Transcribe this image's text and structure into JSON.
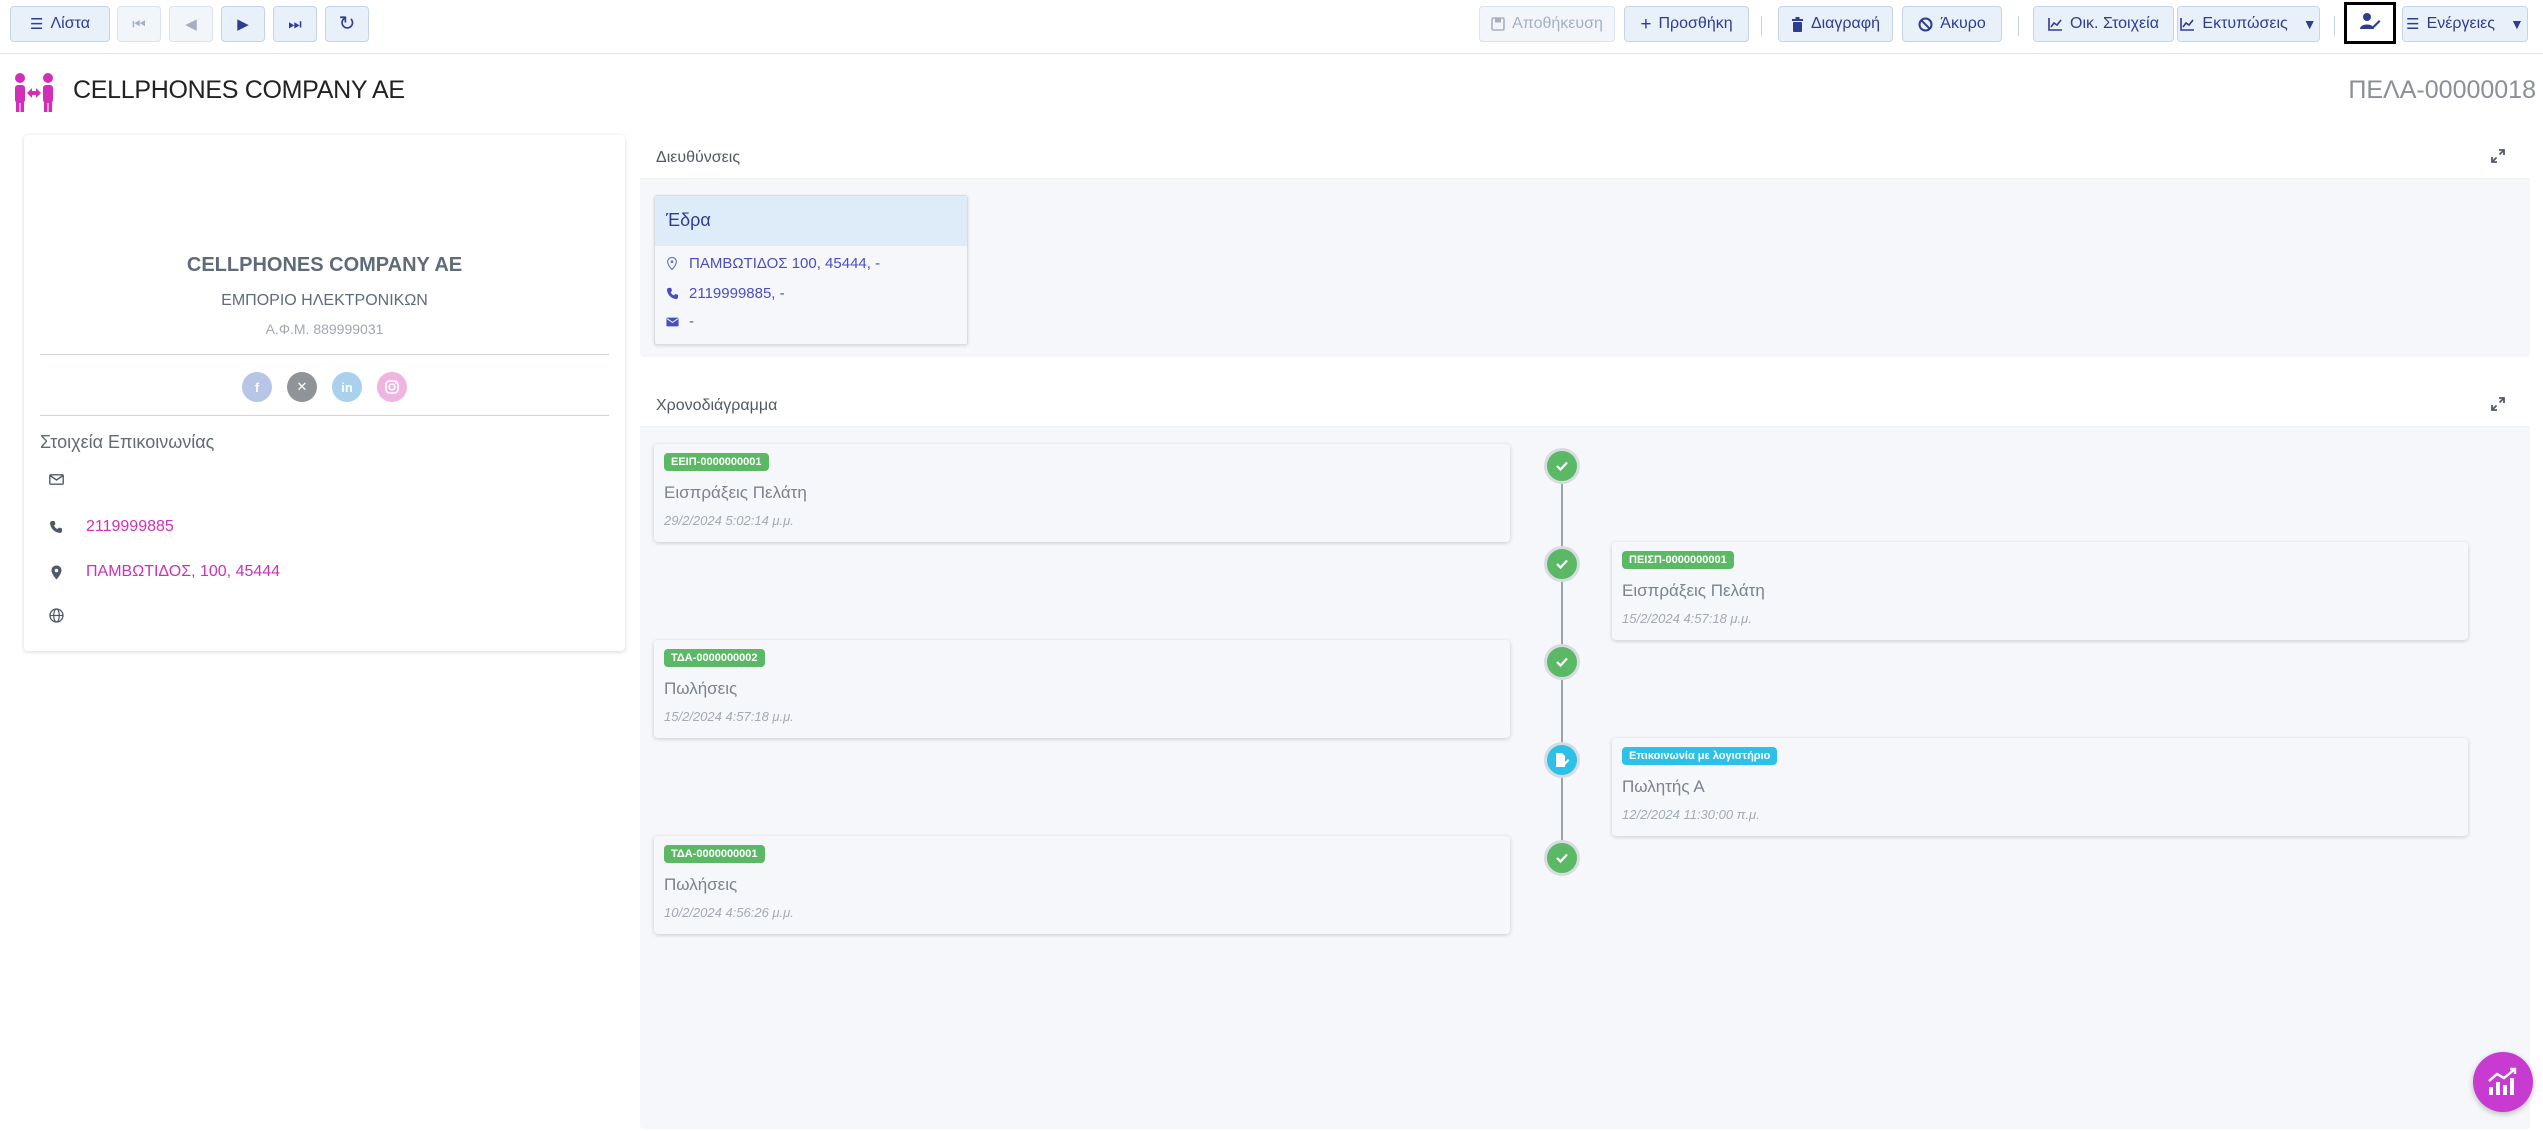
{
  "toolbar": {
    "list_label": "Λίστα",
    "save_label": "Αποθήκευση",
    "add_label": "Προσθήκη",
    "delete_label": "Διαγραφή",
    "cancel_label": "Άκυρο",
    "financials_label": "Οικ. Στοιχεία",
    "prints_label": "Εκτυπώσεις",
    "actions_label": "Ενέργειες"
  },
  "header": {
    "company_name": "CELLPHONES COMPANY AE",
    "record_code": "ΠΕΛΑ-00000018"
  },
  "profile": {
    "name": "CELLPHONES COMPANY AE",
    "business": "ΕΜΠΟΡΙΟ ΗΛΕΚΤΡΟΝΙΚΩΝ",
    "afm": "Α.Φ.Μ. 889999031",
    "contact_section_title": "Στοιχεία Επικοινωνίας",
    "phone": "2119999885",
    "address": "ΠΑΜΒΩΤΙΔΟΣ, 100, 45444",
    "email": "",
    "website": ""
  },
  "addresses": {
    "title": "Διευθύνσεις",
    "card": {
      "label": "Έδρα",
      "address": "ΠΑΜΒΩΤΙΔΟΣ 100, 45444, -",
      "phone": "2119999885, -",
      "email": "-"
    }
  },
  "timeline": {
    "title": "Χρονοδιάγραμμα",
    "items": [
      {
        "badge": "ΕΕΙΠ-0000000001",
        "desc": "Εισπράξεις Πελάτη",
        "date": "29/2/2024 5:02:14 μ.μ.",
        "type": "ok"
      },
      {
        "badge": "ΠΕΙΣΠ-0000000001",
        "desc": "Εισπράξεις Πελάτη",
        "date": "15/2/2024 4:57:18 μ.μ.",
        "type": "ok"
      },
      {
        "badge": "ΤΔΑ-0000000002",
        "desc": "Πωλήσεις",
        "date": "15/2/2024 4:57:18 μ.μ.",
        "type": "ok"
      },
      {
        "badge": "Επικοινωνία με λογιστήριο",
        "desc": "Πωλητής Α",
        "date": "12/2/2024 11:30:00 π.μ.",
        "type": "doc"
      },
      {
        "badge": "ΤΔΑ-0000000001",
        "desc": "Πωλήσεις",
        "date": "10/2/2024 4:56:26 μ.μ.",
        "type": "ok"
      }
    ]
  },
  "colors": {
    "accent": "#2f3d91",
    "brand_pink": "#d12fb8",
    "success": "#5bb864",
    "info": "#2ec1e8"
  }
}
